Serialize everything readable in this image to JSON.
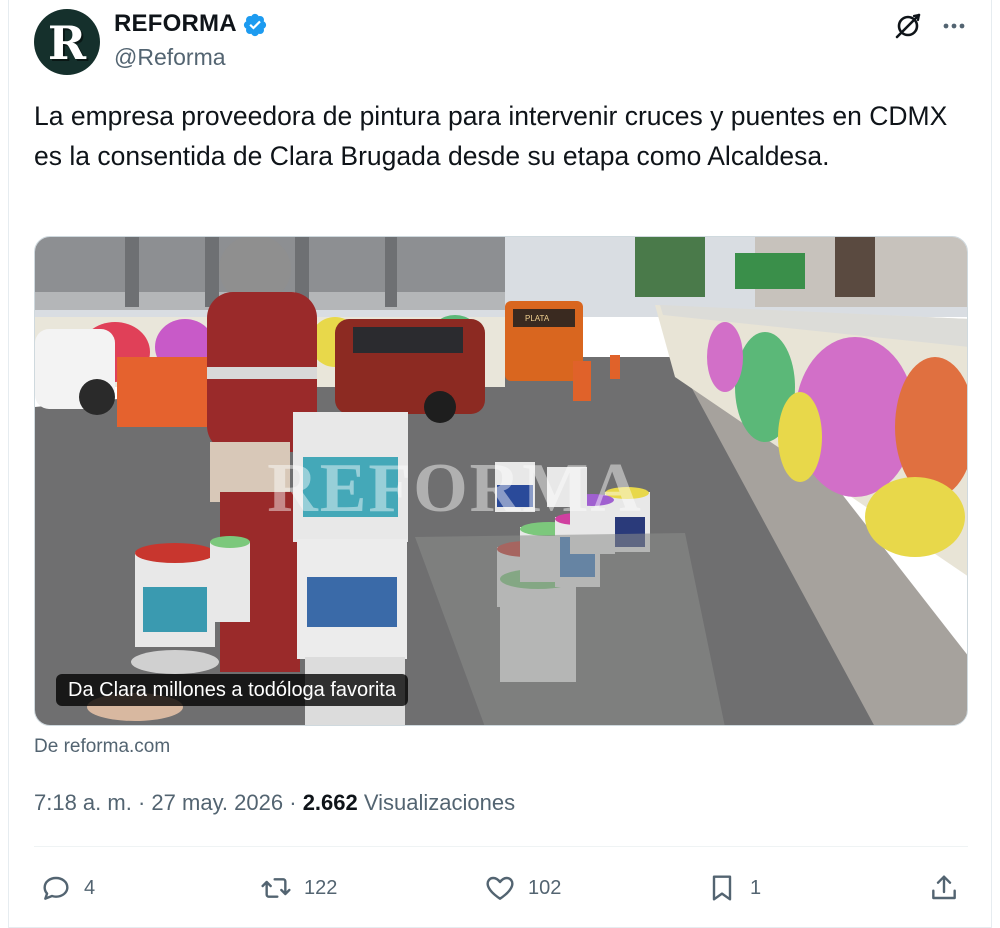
{
  "account": {
    "avatar_letter": "R",
    "name": "REFORMA",
    "handle": "@Reforma",
    "verified_color": "#1d9bf0"
  },
  "tweet": {
    "text": "La empresa proveedora de pintura para intervenir cruces y puentes en CDMX es la consentida de Clara Brugada desde su etapa como Alcaldesa."
  },
  "media": {
    "watermark": "REFORMA",
    "caption": "Da Clara millones a todóloga favorita",
    "bus_sign": "PLATA"
  },
  "source": "De reforma.com",
  "meta": {
    "time": "7:18 a. m.",
    "separator": "·",
    "date": "27 may. 2026",
    "views_count": "2.662",
    "views_label": "Visualizaciones"
  },
  "actions": {
    "replies": "4",
    "reposts": "122",
    "likes": "102",
    "bookmarks": "1"
  },
  "icons": [
    "verified-badge-icon",
    "grok-icon",
    "more-icon",
    "reply-icon",
    "repost-icon",
    "like-icon",
    "bookmark-icon",
    "share-icon"
  ]
}
